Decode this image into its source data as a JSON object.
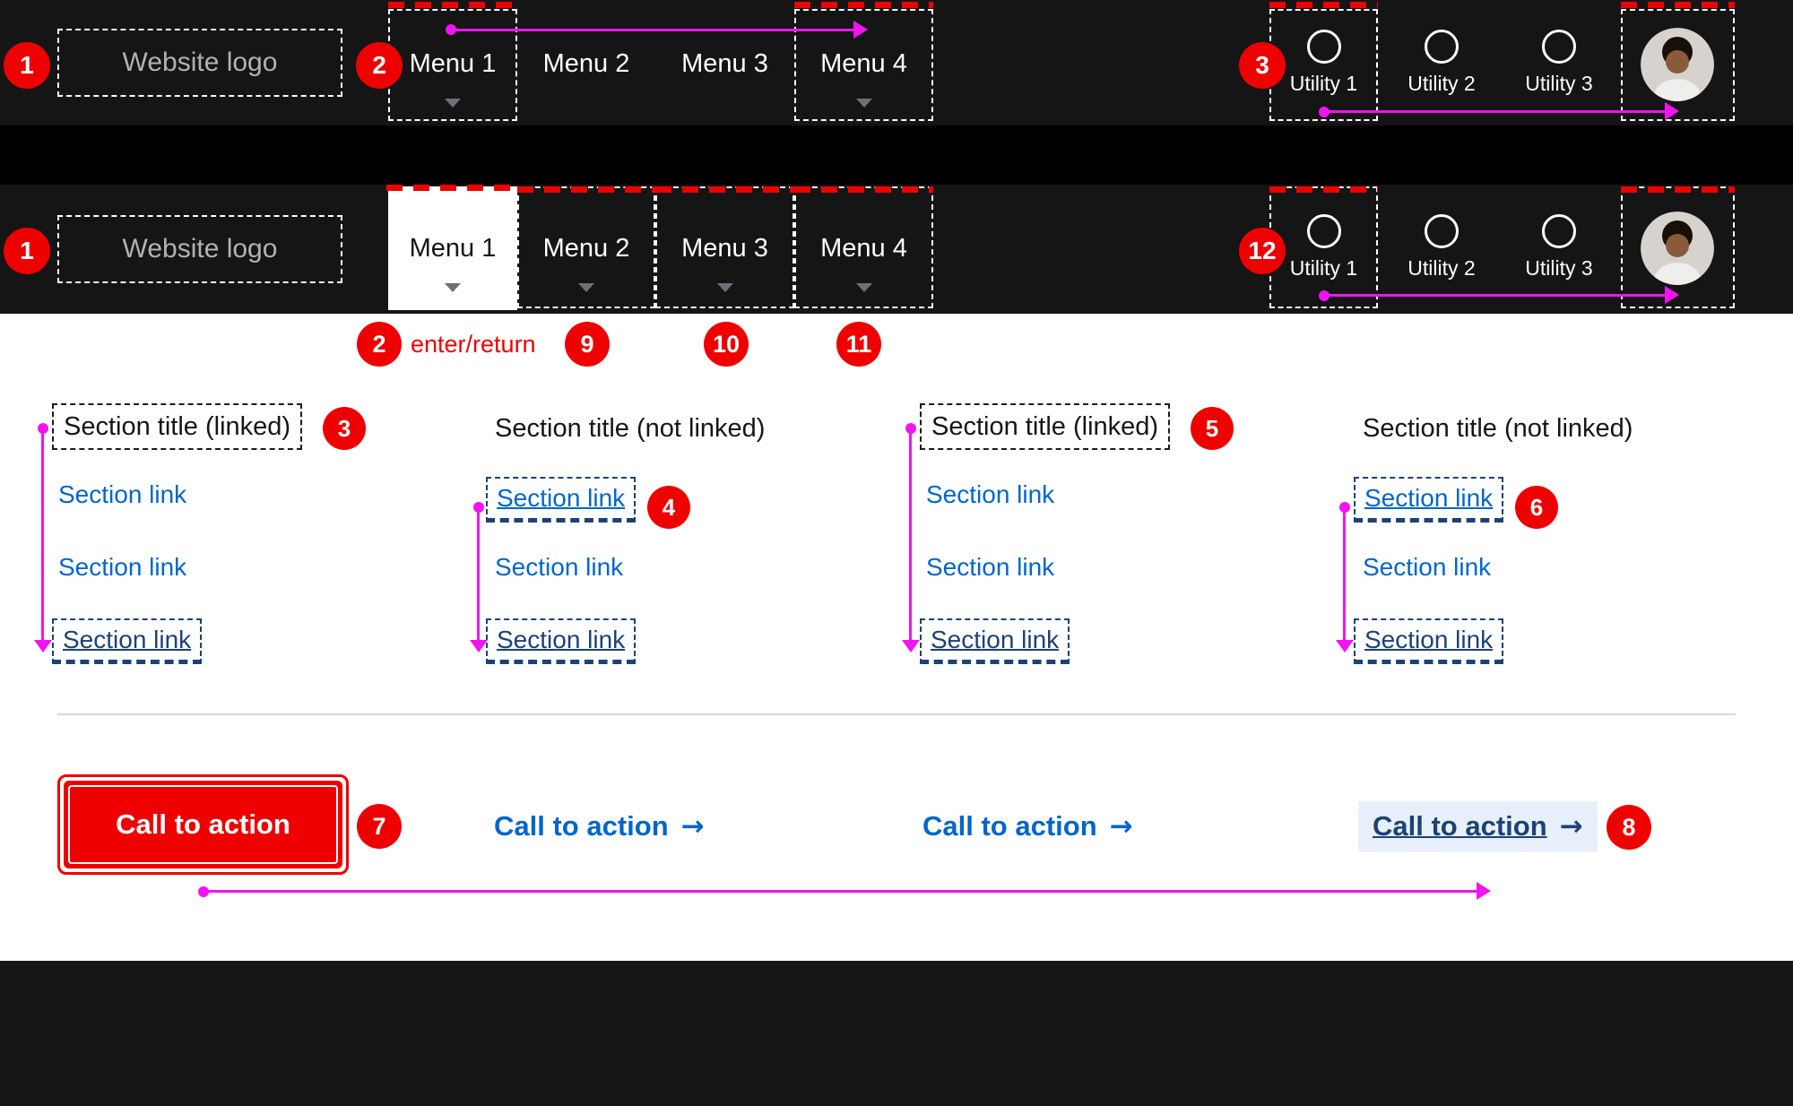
{
  "colors": {
    "accent_red": "#ee0000",
    "annotation_magenta": "#f213f2",
    "link_blue": "#0066cc",
    "link_navy": "#1d4273",
    "cta_highlight_bg": "#e7f0fa",
    "nav_bar_bg": "#151515",
    "gap_band_bg": "#000000",
    "footer_bg": "#161616",
    "logo_text": "#b0b2b5"
  },
  "icons": {
    "arrow_right": "→"
  },
  "nav": {
    "logo_label": "Website logo",
    "menus": [
      "Menu 1",
      "Menu 2",
      "Menu 3",
      "Menu 4"
    ],
    "utilities": [
      "Utility 1",
      "Utility 2",
      "Utility 3"
    ]
  },
  "annotations": {
    "collapsed_bar": {
      "logo_badge": "1",
      "menu_badge": "2",
      "utility_badge": "3"
    },
    "expanded_bar": {
      "logo_badge": "1",
      "utility_badge": "12"
    },
    "key_hints": {
      "menu1_badge": "2",
      "menu1_key": "enter/return",
      "menu2_badge": "9",
      "menu3_badge": "10",
      "menu4_badge": "11"
    },
    "megamenu": {
      "col1_title_badge": "3",
      "col2_link_badge": "4",
      "col3_title_badge": "5",
      "col4_link_badge": "6",
      "cta_button_badge": "7",
      "cta_link_badge": "8"
    }
  },
  "megamenu": {
    "columns": [
      {
        "title": "Section title (linked)",
        "links": [
          "Section link",
          "Section link",
          "Section link"
        ],
        "cta": "Call to action"
      },
      {
        "title": "Section title (not linked)",
        "links": [
          "Section link",
          "Section link",
          "Section link"
        ],
        "cta": "Call to action"
      },
      {
        "title": "Section title (linked)",
        "links": [
          "Section link",
          "Section link",
          "Section link"
        ],
        "cta": "Call to action"
      },
      {
        "title": "Section title (not linked)",
        "links": [
          "Section link",
          "Section link",
          "Section link"
        ],
        "cta": "Call to action"
      }
    ]
  }
}
